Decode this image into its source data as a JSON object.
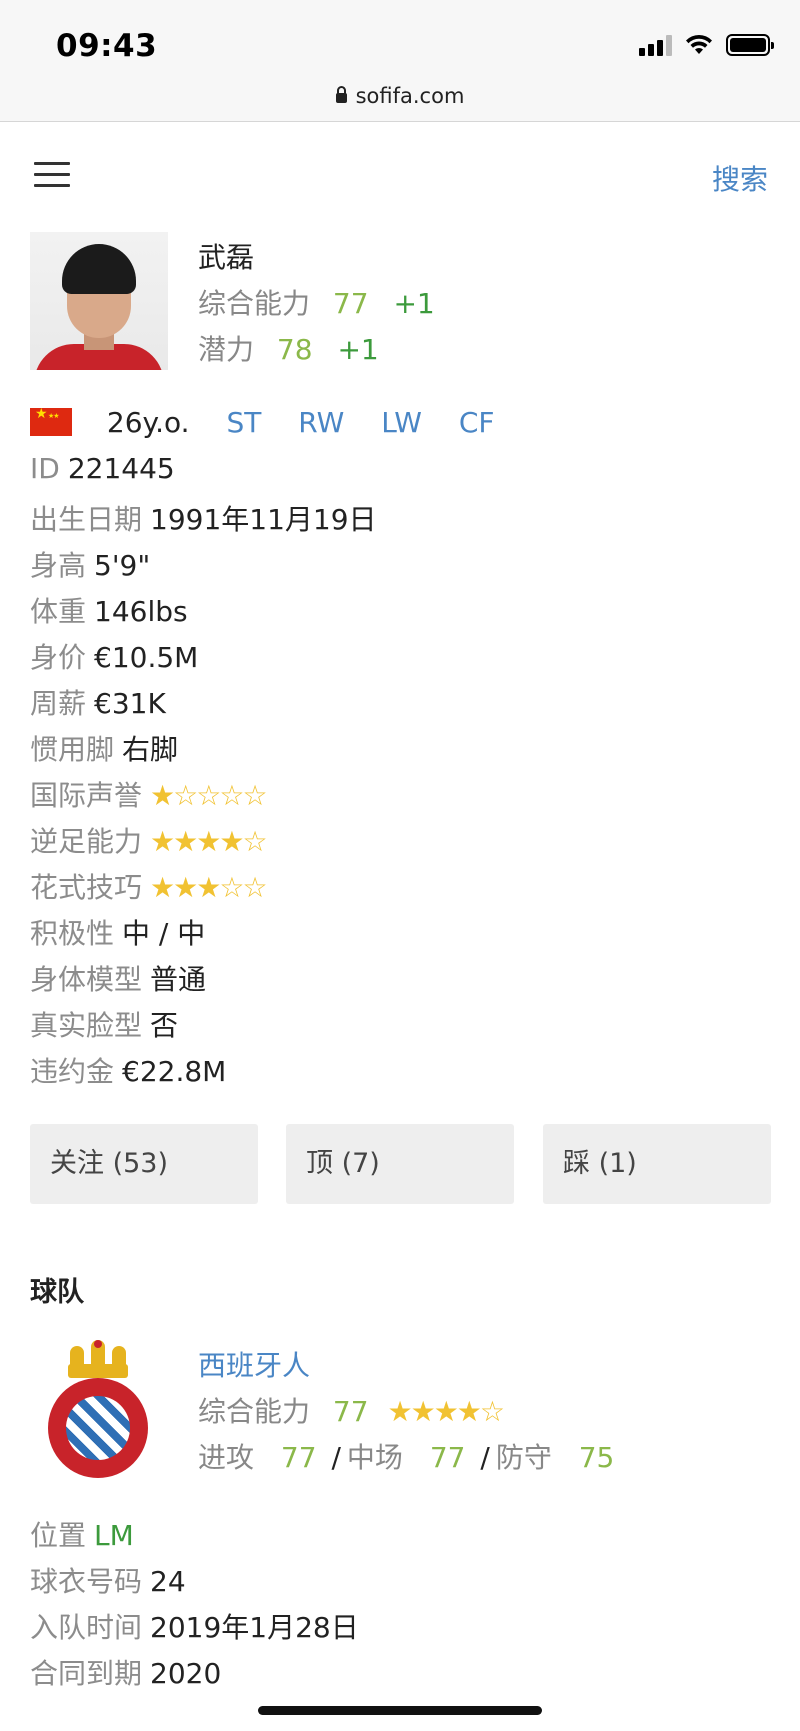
{
  "status_bar": {
    "time": "09:43",
    "url": "sofifa.com"
  },
  "header": {
    "search_label": "搜索"
  },
  "player": {
    "name": "武磊",
    "overall_label": "综合能力",
    "overall": "77",
    "overall_delta": "+1",
    "potential_label": "潜力",
    "potential": "78",
    "potential_delta": "+1",
    "age": "26y.o.",
    "positions": [
      "ST",
      "RW",
      "LW",
      "CF"
    ],
    "nationality_flag": "china-flag"
  },
  "info": {
    "id_label": "ID",
    "id": "221445",
    "birth_label": "出生日期",
    "birth": "1991年11月19日",
    "height_label": "身高",
    "height": "5'9\"",
    "weight_label": "体重",
    "weight": "146lbs",
    "value_label": "身价",
    "value": "€10.5M",
    "wage_label": "周薪",
    "wage": "€31K",
    "foot_label": "惯用脚",
    "foot": "右脚",
    "reputation_label": "国际声誉",
    "reputation_stars": 1,
    "weakfoot_label": "逆足能力",
    "weakfoot_stars": 4,
    "skill_label": "花式技巧",
    "skill_stars": 3,
    "workrate_label": "积极性",
    "workrate": "中 / 中",
    "body_label": "身体模型",
    "body": "普通",
    "realface_label": "真实脸型",
    "realface": "否",
    "release_label": "违约金",
    "release": "€22.8M"
  },
  "buttons": {
    "follow": "关注 (53)",
    "like": "顶 (7)",
    "dislike": "踩 (1)"
  },
  "team": {
    "section_title": "球队",
    "club_name": "西班牙人",
    "overall_label": "综合能力",
    "overall": "77",
    "club_stars": 4,
    "attack_label": "进攻",
    "attack": "77",
    "midfield_label": "中场",
    "midfield": "77",
    "defense_label": "防守",
    "defense": "75",
    "position_label": "位置",
    "position": "LM",
    "jersey_label": "球衣号码",
    "jersey": "24",
    "joined_label": "入队时间",
    "joined": "2019年1月28日",
    "contract_label": "合同到期",
    "contract": "2020"
  },
  "colors": {
    "link": "#4a86c5",
    "rating": "#8bb84a",
    "delta": "#3c9a3c",
    "star": "#f1c232"
  }
}
